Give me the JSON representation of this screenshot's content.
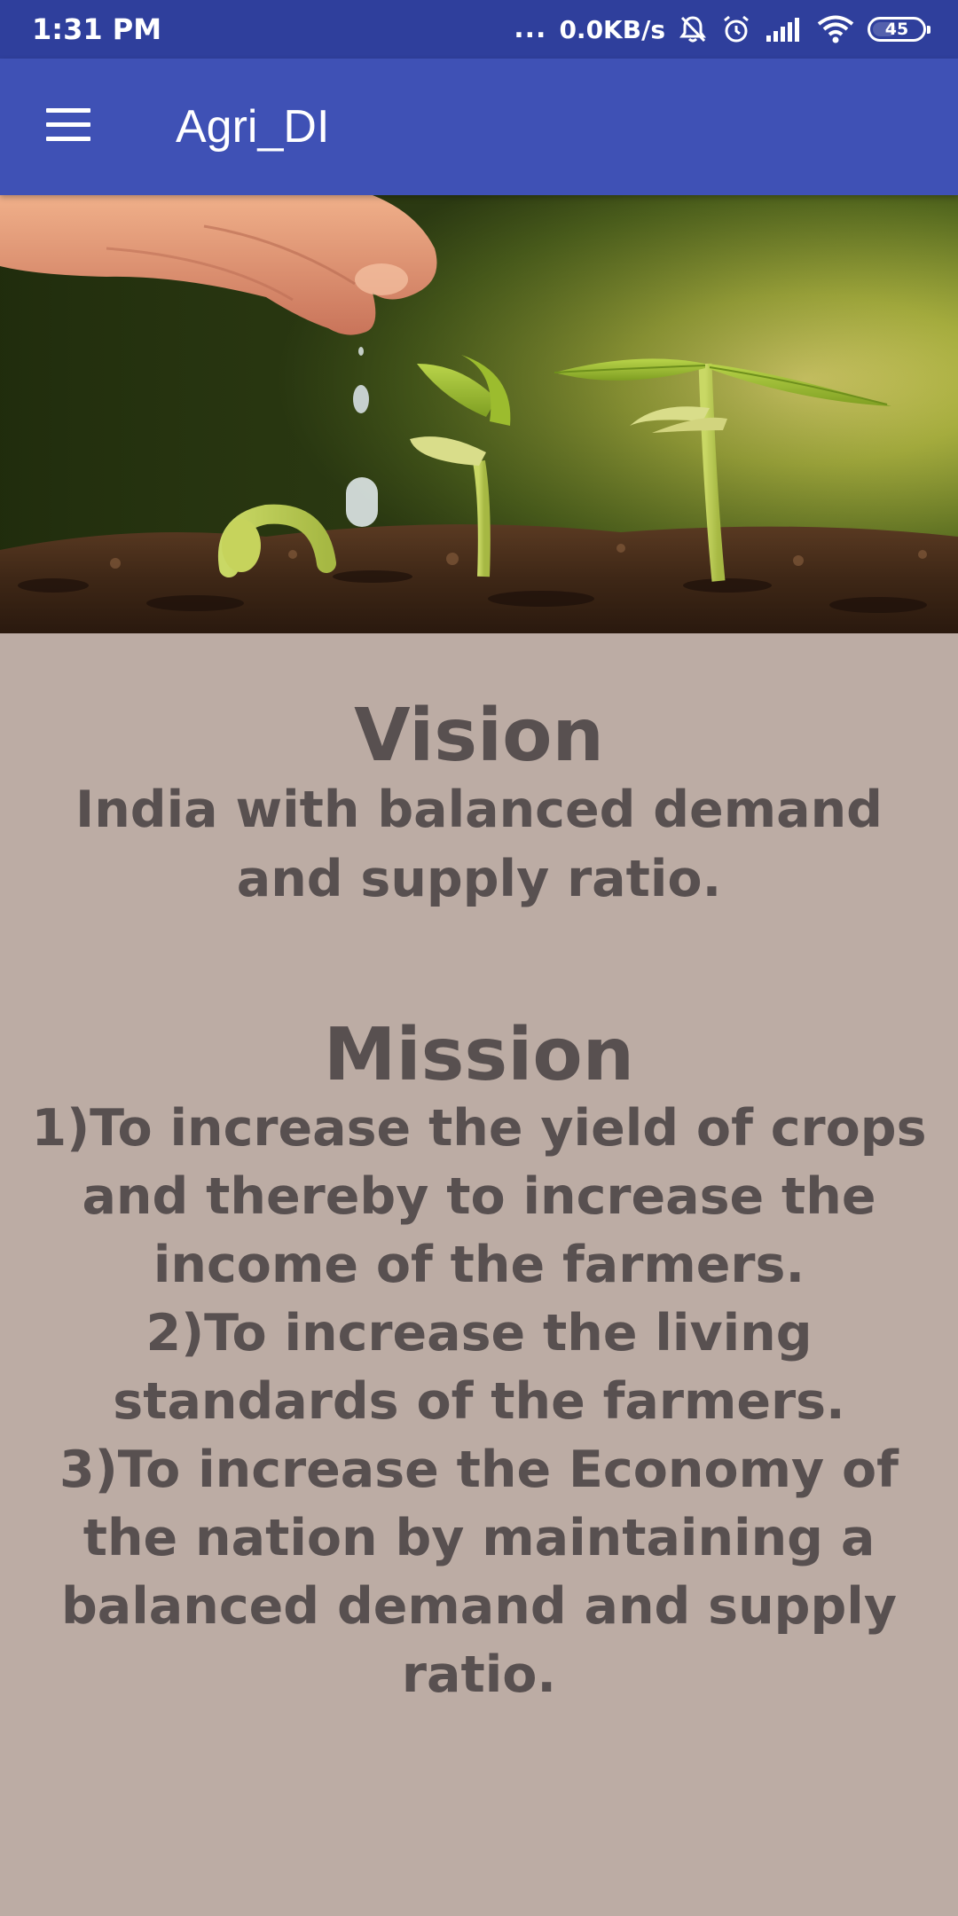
{
  "status_bar": {
    "time": "1:31 PM",
    "dots": "...",
    "network_speed": "0.0KB/s",
    "battery_level": "45",
    "icons": [
      "notifications-muted-icon",
      "alarm-icon",
      "signal-icon",
      "wifi-icon",
      "battery-icon"
    ]
  },
  "app_bar": {
    "title": "Agri_DI",
    "menu_icon": "hamburger-menu-icon"
  },
  "hero_image": {
    "subject": "hand-watering-seedlings-image"
  },
  "vision": {
    "heading": "Vision",
    "text": "India with balanced demand and supply ratio."
  },
  "mission": {
    "heading": "Mission",
    "items": [
      "1)To increase the yield of crops and thereby to increase the income of the farmers.",
      "2)To increase the living standards of the farmers.",
      "3)To increase the Economy of the nation by maintaining a balanced demand and supply ratio."
    ]
  },
  "colors": {
    "status_bar": "#2f3f9c",
    "app_bar": "#3f51b5",
    "background": "#bcaca4",
    "text": "#585050"
  }
}
